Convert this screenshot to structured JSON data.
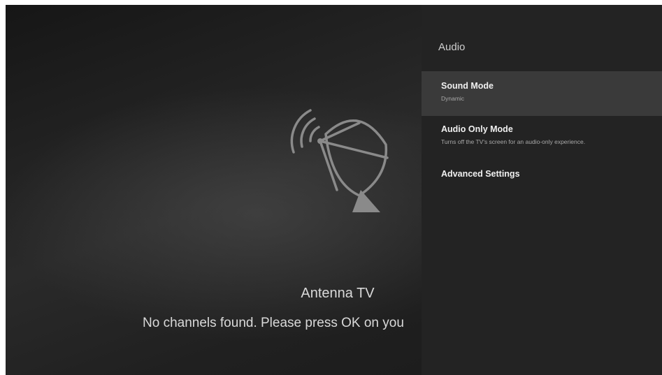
{
  "tv": {
    "title": "Antenna TV",
    "message": "No channels found. Please press OK on you",
    "icon": "satellite-dish-icon"
  },
  "panel": {
    "title": "Audio",
    "items": [
      {
        "label": "Sound Mode",
        "value": "Dynamic",
        "selected": true
      },
      {
        "label": "Audio Only Mode",
        "description": "Turns off the TV's screen for an audio-only experience.",
        "selected": false
      },
      {
        "label": "Advanced Settings",
        "selected": false
      }
    ]
  },
  "colors": {
    "panel_bg": "#232323",
    "selected_bg": "#3a3a3a",
    "text_primary": "#f0f0f0",
    "text_secondary": "#a8a8a8"
  }
}
